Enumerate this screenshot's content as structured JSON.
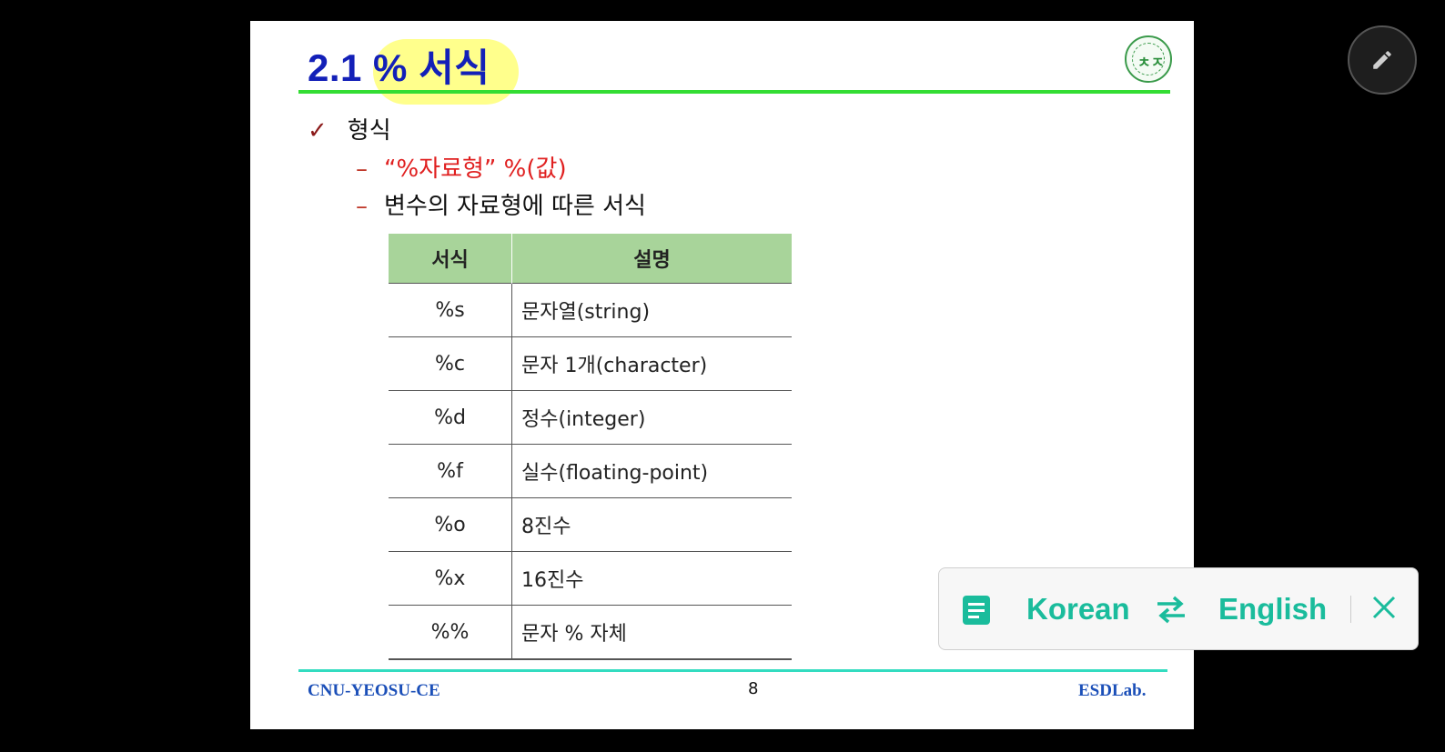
{
  "slide": {
    "title": "2.1 % 서식",
    "bullet": "형식",
    "sub_items": [
      {
        "text": "“%자료형” %(값)"
      },
      {
        "text": "변수의 자료형에 따른 서식"
      }
    ],
    "table": {
      "headers": [
        "서식",
        "설명"
      ],
      "rows": [
        [
          "%s",
          "문자열(string)"
        ],
        [
          "%c",
          "문자 1개(character)"
        ],
        [
          "%d",
          "정수(integer)"
        ],
        [
          "%f",
          "실수(floating-point)"
        ],
        [
          "%o",
          "8진수"
        ],
        [
          "%x",
          "16진수"
        ],
        [
          "%%",
          "문자 % 자체"
        ]
      ]
    },
    "footer": {
      "left": "CNU-YEOSU-CE",
      "page": "8",
      "right": "ESDLab."
    }
  },
  "overlay": {
    "pen_icon": "pencil-icon",
    "translate": {
      "source_lang": "Korean",
      "target_lang": "English",
      "accent": "#1abc9c"
    }
  }
}
